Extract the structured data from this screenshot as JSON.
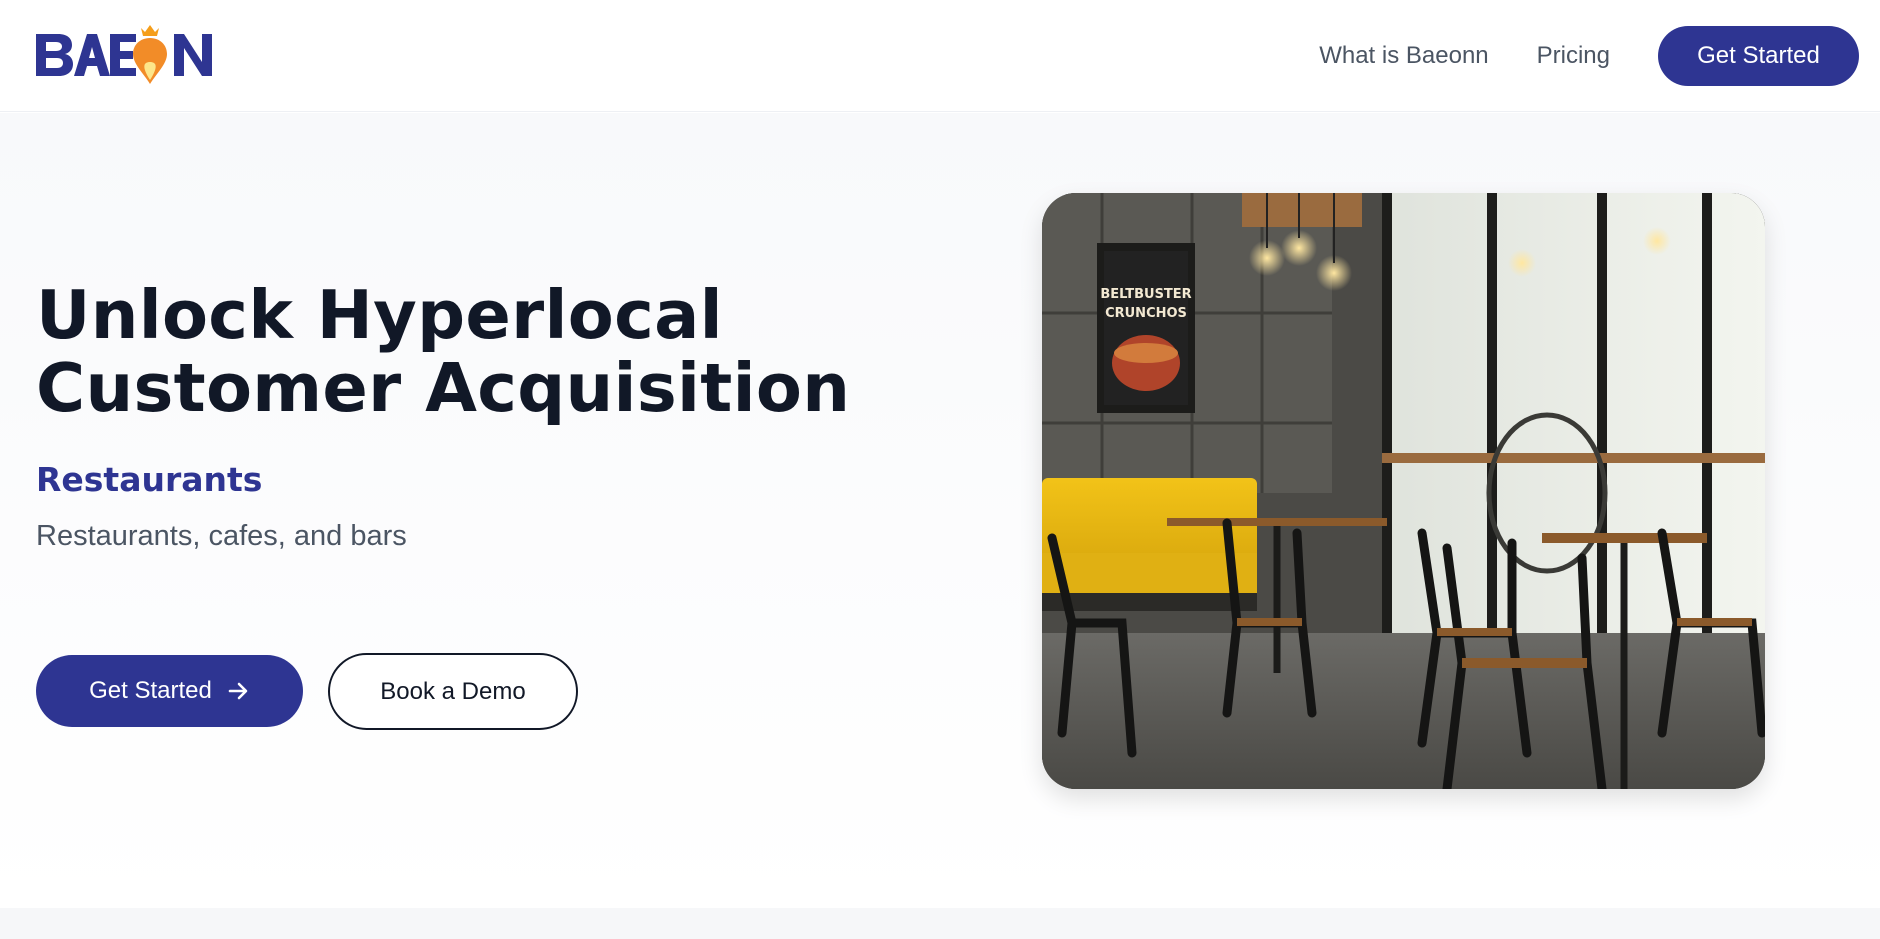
{
  "brand": {
    "logo_text": "BAEON",
    "primary_color": "#2e3592",
    "accent_color": "#f59e1b"
  },
  "nav": {
    "items": [
      {
        "label": "What is Baeonn"
      },
      {
        "label": "Pricing"
      }
    ],
    "cta_label": "Get Started"
  },
  "hero": {
    "title_line1": "Unlock Hyperlocal",
    "title_line2": "Customer Acquisition",
    "category": "Restaurants",
    "subtitle": "Restaurants, cafes, and bars",
    "primary_button": "Get Started",
    "secondary_button": "Book a Demo",
    "image": {
      "poster_line1": "BELTBUSTER",
      "poster_line2": "CRUNCHOS"
    }
  },
  "icons": {
    "arrow": "arrow-right-icon",
    "logo_mark": "location-pin-crown-icon"
  }
}
